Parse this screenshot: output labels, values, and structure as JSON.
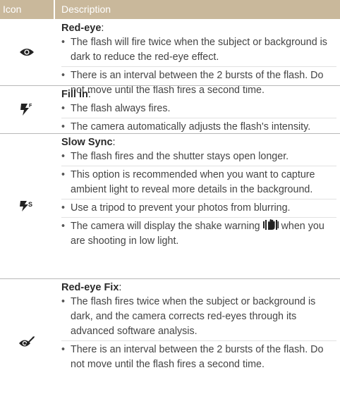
{
  "header": {
    "icon_label": "Icon",
    "description_label": "Description"
  },
  "rows": [
    {
      "icon": "red-eye-icon",
      "title": "Red-eye",
      "bullets": [
        "The flash will fire twice when the subject or background is dark to reduce the red-eye effect.",
        "There is an interval between the 2 bursts of the flash. Do not move until the flash fires a second time."
      ]
    },
    {
      "icon": "fill-in-flash-icon",
      "title": "Fill in",
      "bullets": [
        "The flash always fires.",
        "The camera automatically adjusts the flash's intensity."
      ]
    },
    {
      "icon": "slow-sync-flash-icon",
      "title": "Slow Sync",
      "bullets": [
        "The flash fires and the shutter stays open longer.",
        "This option is recommended when you want to capture ambient light to reveal more details in the background.",
        "Use a tripod to prevent your photos from blurring.",
        "The camera will display the shake warning",
        "when you are shooting in low light."
      ]
    },
    {
      "icon": "red-eye-fix-icon",
      "title": "Red-eye Fix",
      "bullets": [
        "The flash fires twice when the subject or background is dark, and the camera corrects red-eyes through its advanced software analysis.",
        "There is an interval between the 2 bursts of the flash. Do not move until the flash fires a second time."
      ]
    }
  ]
}
